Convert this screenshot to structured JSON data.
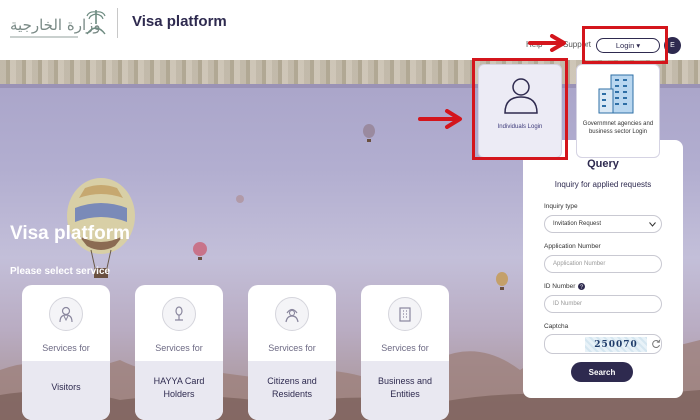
{
  "header": {
    "logo_text": "وزارة الخارجية",
    "brand": "Visa platform",
    "nav": {
      "help": "Help",
      "support": "Support"
    },
    "login_label": "Login ▾",
    "lang_label": "E"
  },
  "login_menu": {
    "items": [
      {
        "label": "Individuals Login",
        "icon": "person-icon"
      },
      {
        "label": "Governmnet agencies and business sector Login",
        "icon": "building-icon"
      }
    ]
  },
  "hero": {
    "title": "Visa platform",
    "subtitle": "Please select service"
  },
  "services": [
    {
      "prefix": "Services for",
      "name": "Visitors",
      "icon": "visitor-icon"
    },
    {
      "prefix": "Services for",
      "name": "HAYYA Card Holders",
      "icon": "hayya-icon"
    },
    {
      "prefix": "Services for",
      "name": "Citizens and Residents",
      "icon": "citizen-icon"
    },
    {
      "prefix": "Services for",
      "name": "Business and Entities",
      "icon": "building-icon"
    }
  ],
  "query": {
    "title": "Query",
    "subtitle": "Inquiry for applied requests",
    "inquiry_type_label": "Inquiry type",
    "inquiry_type_value": "Invitation Request",
    "application_number_label": "Application Number",
    "application_number_placeholder": "Application Number",
    "id_number_label": "ID Number",
    "id_number_placeholder": "ID Number",
    "captcha_label": "Captcha",
    "captcha_text": "250070",
    "search_label": "Search"
  },
  "colors": {
    "brand": "#2e2a4f",
    "annotation": "#d4151c"
  }
}
